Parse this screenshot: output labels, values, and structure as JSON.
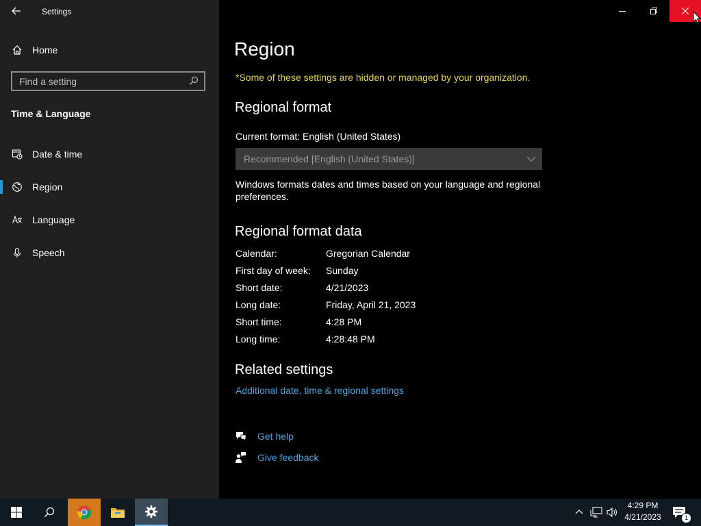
{
  "window": {
    "title": "Settings",
    "controls": {
      "minimize": "minimize-icon",
      "restore": "restore-icon",
      "close": "close-icon"
    }
  },
  "sidebar": {
    "home_label": "Home",
    "search_placeholder": "Find a setting",
    "section_title": "Time & Language",
    "items": [
      {
        "label": "Date & time",
        "icon": "calendar-clock-icon"
      },
      {
        "label": "Region",
        "icon": "globe-icon",
        "active": true
      },
      {
        "label": "Language",
        "icon": "language-icon"
      },
      {
        "label": "Speech",
        "icon": "microphone-icon"
      }
    ]
  },
  "main": {
    "title": "Region",
    "notice": "*Some of these settings are hidden or managed by your organization.",
    "regional_format": {
      "heading": "Regional format",
      "current_format": "Current format: English (United States)",
      "dropdown_value": "Recommended [English (United States)]",
      "description_line1": "Windows formats dates and times based on your language and regional",
      "description_line2": "preferences."
    },
    "format_data": {
      "heading": "Regional format data",
      "rows": [
        {
          "label": "Calendar:",
          "value": "Gregorian Calendar"
        },
        {
          "label": "First day of week:",
          "value": "Sunday"
        },
        {
          "label": "Short date:",
          "value": "4/21/2023"
        },
        {
          "label": "Long date:",
          "value": "Friday, April 21, 2023"
        },
        {
          "label": "Short time:",
          "value": "4:28 PM"
        },
        {
          "label": "Long time:",
          "value": "4:28:48 PM"
        }
      ]
    },
    "related": {
      "heading": "Related settings",
      "link": "Additional date, time & regional settings"
    },
    "help": {
      "get_help": "Get help",
      "give_feedback": "Give feedback"
    }
  },
  "taskbar": {
    "time": "4:29 PM",
    "date": "4/21/2023",
    "notification_count": "1"
  },
  "colors": {
    "accent": "#1a9ae0",
    "notice": "#e8d44d",
    "link": "#4aa3df",
    "close": "#e81123"
  }
}
